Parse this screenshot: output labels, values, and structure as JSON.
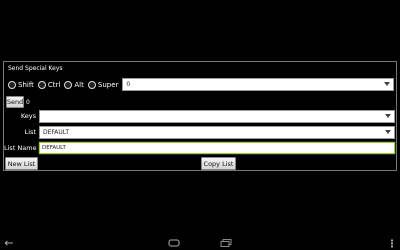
{
  "panel": {
    "title": "Send Special Keys"
  },
  "modifiers": [
    {
      "label": "Shift"
    },
    {
      "label": "Ctrl"
    },
    {
      "label": "Alt"
    },
    {
      "label": "Super"
    }
  ],
  "key_select": {
    "value": "0"
  },
  "send": {
    "label": "Send",
    "count": "0"
  },
  "keys": {
    "label": "Keys",
    "value": ""
  },
  "list": {
    "label": "List",
    "value": "DEFAULT"
  },
  "list_name": {
    "label": "List Name",
    "value": "DEFAULT"
  },
  "buttons": {
    "new_list": "New List",
    "copy_list": "Copy List"
  },
  "navbar": {
    "icons": [
      "back-icon",
      "home-icon",
      "recent-apps-icon",
      "menu-icon"
    ]
  }
}
